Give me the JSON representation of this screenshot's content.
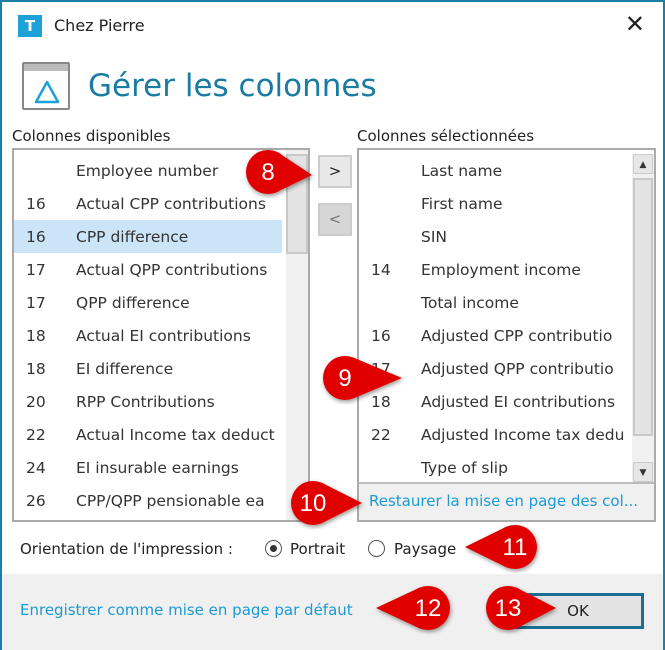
{
  "window": {
    "title": "Chez Pierre",
    "close": "✕",
    "app_icon": "T"
  },
  "header": {
    "title": "Gérer les colonnes",
    "icon": "layout-triangle-icon"
  },
  "available": {
    "label": "Colonnes disponibles",
    "items": [
      {
        "num": "",
        "name": "Employee number"
      },
      {
        "num": "16",
        "name": "Actual CPP contributions"
      },
      {
        "num": "16",
        "name": "CPP difference",
        "selected": true
      },
      {
        "num": "17",
        "name": "Actual QPP contributions"
      },
      {
        "num": "17",
        "name": "QPP difference"
      },
      {
        "num": "18",
        "name": "Actual EI contributions"
      },
      {
        "num": "18",
        "name": "EI difference"
      },
      {
        "num": "20",
        "name": "RPP Contributions"
      },
      {
        "num": "22",
        "name": "Actual Income tax deduct"
      },
      {
        "num": "24",
        "name": "EI insurable earnings"
      },
      {
        "num": "26",
        "name": "CPP/QPP pensionable ea"
      }
    ]
  },
  "buttons": {
    "add": ">",
    "remove": "<",
    "ok": "OK"
  },
  "selected": {
    "label": "Colonnes sélectionnées",
    "items": [
      {
        "num": "",
        "name": "Last name"
      },
      {
        "num": "",
        "name": "First name"
      },
      {
        "num": "",
        "name": "SIN"
      },
      {
        "num": "14",
        "name": "Employment income"
      },
      {
        "num": "",
        "name": "Total income"
      },
      {
        "num": "16",
        "name": "Adjusted CPP contributio"
      },
      {
        "num": "17",
        "name": "Adjusted QPP contributio"
      },
      {
        "num": "18",
        "name": "Adjusted EI contributions"
      },
      {
        "num": "22",
        "name": "Adjusted Income tax dedu"
      },
      {
        "num": "",
        "name": "Type of slip"
      }
    ],
    "restore": "Restaurer la mise en page des col..."
  },
  "orientation": {
    "label": "Orientation de l'impression :",
    "options": [
      "Portrait",
      "Paysage"
    ],
    "value": "Portrait"
  },
  "footer": {
    "save_default": "Enregistrer comme mise en page par défaut"
  },
  "callouts": [
    "8",
    "9",
    "10",
    "11",
    "12",
    "13"
  ],
  "colors": {
    "accent": "#1a7ba3",
    "link": "#1a9ad6",
    "callout": "#e00000",
    "selection": "#cce4f7"
  }
}
